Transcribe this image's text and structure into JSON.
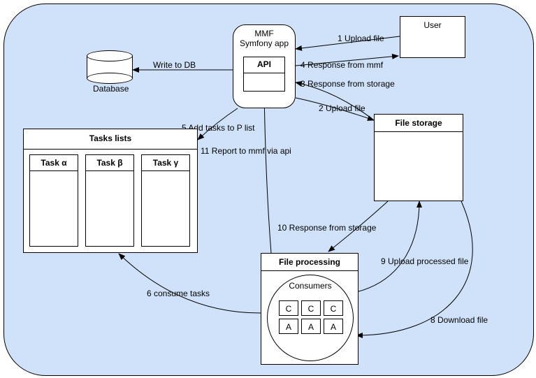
{
  "nodes": {
    "user": {
      "label": "User"
    },
    "mmf": {
      "line1": "MMF",
      "line2": "Symfony app"
    },
    "api": {
      "label": "API"
    },
    "database": {
      "label": "Database"
    },
    "tasks_lists": {
      "title": "Tasks lists"
    },
    "task_alpha": {
      "label": "Task α"
    },
    "task_beta": {
      "label": "Task β"
    },
    "task_gamma": {
      "label": "Task γ"
    },
    "file_storage": {
      "label": "File storage"
    },
    "file_processing": {
      "label": "File processing"
    },
    "consumers_label": "Consumers",
    "consumer_cells": {
      "c": "C",
      "a": "A"
    }
  },
  "edges": {
    "e1": {
      "label": "1 Upload file"
    },
    "e2": {
      "label": "2 Upload file"
    },
    "e3": {
      "label": "3 Response from storage"
    },
    "e4": {
      "label": "4 Response from mmf"
    },
    "e5": {
      "label": "5 Add tasks to P list"
    },
    "e6": {
      "label": "6 consume tasks"
    },
    "e8": {
      "label": "8 Download file"
    },
    "e9": {
      "label": "9 Upload processed file"
    },
    "e10": {
      "label": "10 Response from storage"
    },
    "e11": {
      "label": "11 Report to mmf via api"
    },
    "write_db": {
      "label": "Write to DB"
    }
  }
}
